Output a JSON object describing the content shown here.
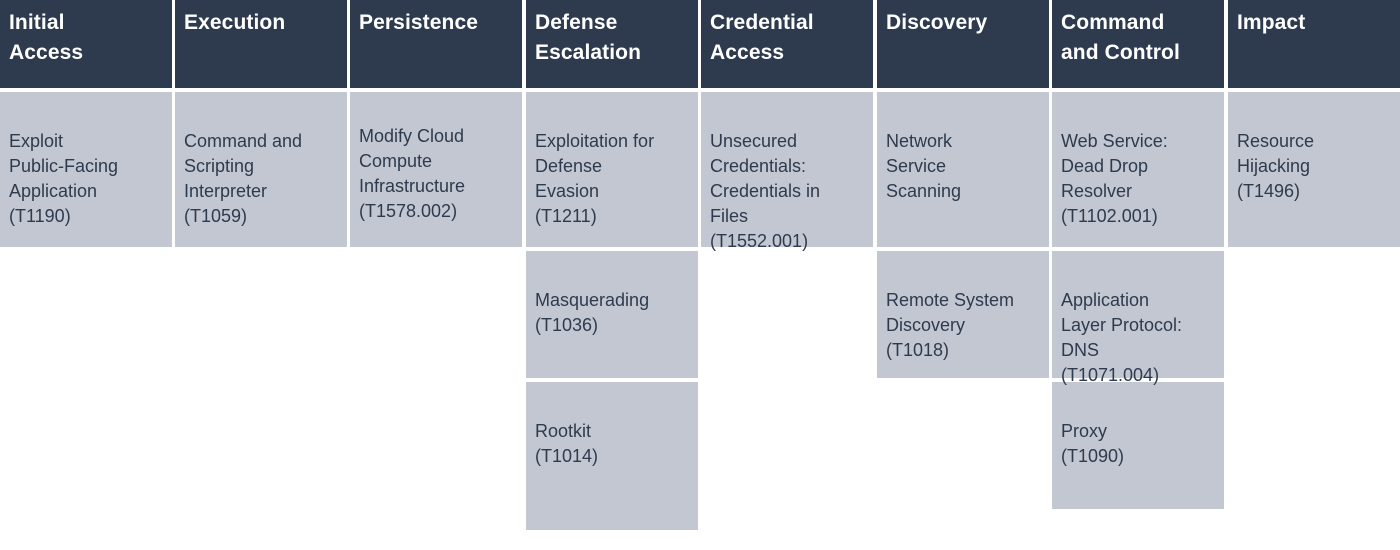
{
  "tactics": [
    {
      "name": "Initial\nAccess",
      "techniques": [
        {
          "name": "Exploit\nPublic-Facing\nApplication",
          "id": "(T1190)"
        }
      ]
    },
    {
      "name": "Execution",
      "techniques": [
        {
          "name": "Command and\nScripting\nInterpreter",
          "id": "(T1059)"
        }
      ]
    },
    {
      "name": "Persistence",
      "techniques": [
        {
          "name": "Modify Cloud\nCompute\nInfrastructure",
          "id": "(T1578.002)"
        }
      ]
    },
    {
      "name": "Defense\nEscalation",
      "techniques": [
        {
          "name": "Exploitation for\nDefense\nEvasion",
          "id": "(T1211)"
        },
        {
          "name": "Masquerading",
          "id": "(T1036)"
        },
        {
          "name": "Rootkit",
          "id": "(T1014)"
        }
      ]
    },
    {
      "name": "Credential\nAccess",
      "techniques": [
        {
          "name": "Unsecured\nCredentials:\nCredentials in\nFiles",
          "id": "(T1552.001)"
        }
      ]
    },
    {
      "name": "Discovery",
      "techniques": [
        {
          "name": "Network\nService\nScanning",
          "id": ""
        },
        {
          "name": "Remote System\nDiscovery",
          "id": "(T1018)"
        }
      ]
    },
    {
      "name": "Command\nand Control",
      "techniques": [
        {
          "name": "Web Service:\nDead Drop\nResolver",
          "id": "(T1102.001)"
        },
        {
          "name": "Application\nLayer Protocol:\nDNS",
          "id": "(T1071.004)"
        },
        {
          "name": "Proxy",
          "id": "(T1090)"
        }
      ]
    },
    {
      "name": "Impact",
      "techniques": [
        {
          "name": "Resource\nHijacking",
          "id": "(T1496)"
        }
      ]
    }
  ],
  "colors": {
    "header_bg": "#2e3b4e",
    "header_text": "#ffffff",
    "cell_bg": "#c3c7d1",
    "cell_text": "#2e3b4e"
  }
}
